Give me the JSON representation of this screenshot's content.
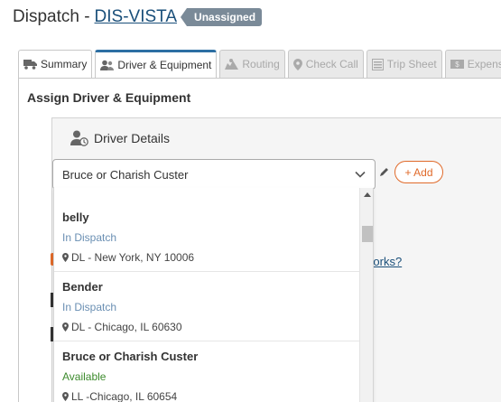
{
  "header": {
    "prefix": "Dispatch - ",
    "load_link": "DIS-VISTA",
    "status_badge": "Unassigned"
  },
  "tabs": [
    {
      "label": "Summary",
      "icon": "truck-icon",
      "state": "enabled"
    },
    {
      "label": "Driver & Equipment",
      "icon": "users-icon",
      "state": "active"
    },
    {
      "label": "Routing",
      "icon": "map-icon",
      "state": "disabled"
    },
    {
      "label": "Check Call",
      "icon": "map-marker-icon",
      "state": "disabled"
    },
    {
      "label": "Trip Sheet",
      "icon": "clipboard-icon",
      "state": "disabled"
    },
    {
      "label": "Expenses",
      "icon": "money-icon",
      "state": "disabled"
    }
  ],
  "main": {
    "section_title": "Assign Driver & Equipment",
    "driver_card_title": "Driver Details",
    "driver_select_value": "Bruce or Charish Custer",
    "add_button": "+ Add",
    "help_link": "works?"
  },
  "dropdown": {
    "items": [
      {
        "name": "belly",
        "status": "In Dispatch",
        "status_type": "in",
        "location": "DL - New York, NY 10006"
      },
      {
        "name": "Bender",
        "status": "In Dispatch",
        "status_type": "in",
        "location": "DL - Chicago, IL 60630"
      },
      {
        "name": "Bruce or Charish Custer",
        "status": "Available",
        "status_type": "avail",
        "location": "LL -Chicago, IL 60654"
      }
    ]
  },
  "colors": {
    "accent": "#e06a2a",
    "link": "#1a4f7a",
    "available": "#3d8b2d",
    "in_dispatch": "#6a8fb3"
  }
}
